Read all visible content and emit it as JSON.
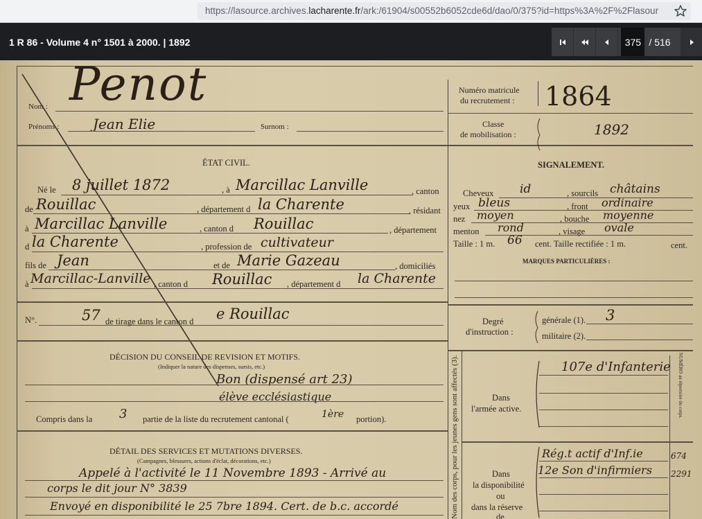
{
  "browser": {
    "url_prefix": "https://lasource.archives.",
    "url_domain": "lacharente.fr",
    "url_suffix": "/ark:/61904/s00552b6052cde6d/dao/0/375?id=https%3A%2F%2Flasour",
    "bookmark_icon": "star-icon"
  },
  "viewer": {
    "title": "1 R 86 - Volume 4 n° 1501 à 2000. | 1892",
    "current_page": "375",
    "total_pages": "/ 516",
    "buttons": {
      "first": "first-page-icon",
      "prev_fast": "rewind-icon",
      "prev": "previous-icon",
      "next": "next-icon"
    }
  },
  "document": {
    "nom_label": "Nom :",
    "nom_value": "Penot",
    "prenoms_label": "Prénoms :",
    "prenoms_value": "Jean Elie",
    "surnom_label": "Surnom :",
    "matricule_label_1": "Numéro matricule",
    "matricule_label_2": "du recrutement :",
    "matricule_value": "1864",
    "classe_label_1": "Classe",
    "classe_label_2": "de mobilisation :",
    "classe_value": "1892",
    "etat_civil": "ÉTAT CIVIL.",
    "signalement": "SIGNALEMENT.",
    "ne_le": "Né le",
    "ne_date": "8 juillet 1872",
    "a_label": ", à",
    "birth_place": "Marcillac Lanville",
    "canton_word": ", canton",
    "de1": "de",
    "canton_val": "Rouillac",
    "dept_label": ", département d",
    "dept_val": "la Charente",
    "residant": ", résidant",
    "a2": "à",
    "res_place": "Marcillac Lanville",
    "canton_d": ", canton d",
    "res_canton": "Rouillac",
    "departement": ", département",
    "d_label": "d",
    "res_dept": "la Charente",
    "profession_label": ", profession de",
    "profession_val": "cultivateur",
    "fils_de": "fils de",
    "father": "Jean",
    "et_de": "et de",
    "mother": "Marie Gazeau",
    "domicilies": ", domiciliés",
    "a3": "à",
    "parents_place": "Marcillac-Lanville",
    "canton_d2": ", canton d",
    "parents_canton": "Rouillac",
    "departement_d": ", département d",
    "parents_dept": "la Charente",
    "cheveux_label": "Cheveux",
    "cheveux_val": "id",
    "sourcils_label": ", sourcils",
    "sourcils_val": "châtains",
    "yeux_label": "yeux",
    "yeux_val": "bleus",
    "front_label": ", front",
    "front_val": "ordinaire",
    "nez_label": "nez",
    "nez_val": "moyen",
    "bouche_label": ", bouche",
    "bouche_val": "moyenne",
    "menton_label": "menton",
    "menton_val": "rond",
    "visage_label": ", visage",
    "visage_val": "ovale",
    "taille_label": "Taille : 1 m.",
    "taille_val": "66",
    "taille_rest": "cent. Taille rectifiée : 1 m.",
    "cent": "cent.",
    "marques": "MARQUES PARTICULIÈRES :",
    "no_label": "N°.",
    "tirage_val": "57",
    "tirage_label": "de tirage dans le canton d",
    "tirage_canton": "e Rouillac",
    "degre_1": "Degré",
    "degre_2": "d'instruction :",
    "generale_label": "générale (1).",
    "generale_val": "3",
    "militaire_label": "militaire (2).",
    "decision_title": "DÉCISION DU CONSEIL DE REVISION ET MOTIFS.",
    "decision_sub": "(Indiquer la nature des dispenses, sursis, etc.)",
    "decision_1": "Bon (dispensé art 23)",
    "decision_2": "élève ecclésiastique",
    "compris_label": "Compris dans la",
    "compris_val": "3",
    "compris_rest": "partie de la liste du recrutement cantonal (",
    "portion_val": "1ère",
    "portion_label": "portion).",
    "active_1": "Dans",
    "active_2": "l'armée active.",
    "active_val": "107e d'Infanterie",
    "vertical_label": "Nom des corps, pour les jeunes gens sont affectés (3).",
    "numero_label": "NUMÉRO au répertoire du corps.",
    "detail_title": "DÉTAIL DES SERVICES ET MUTATIONS DIVERSES.",
    "detail_sub": "(Campagnes, blessures, actions d'éclat, décorations, etc.)",
    "detail_1": "Appelé à l'activité le 11 Novembre 1893 - Arrivé au",
    "detail_2": "corps le dit jour    N° 3839",
    "detail_3": "Envoyé en disponibilité le 25 7bre 1894. Cert. de b.c. accordé",
    "dispo_1": "Dans",
    "dispo_2": "la disponibilité",
    "dispo_3": "ou",
    "dispo_4": "dans la réserve",
    "dispo_5": "de",
    "dispo_val_1": "Rég.t actif d'Inf.ie",
    "dispo_val_2": "12e Son d'infirmiers",
    "dispo_num_1": "674",
    "dispo_num_2": "2291"
  }
}
